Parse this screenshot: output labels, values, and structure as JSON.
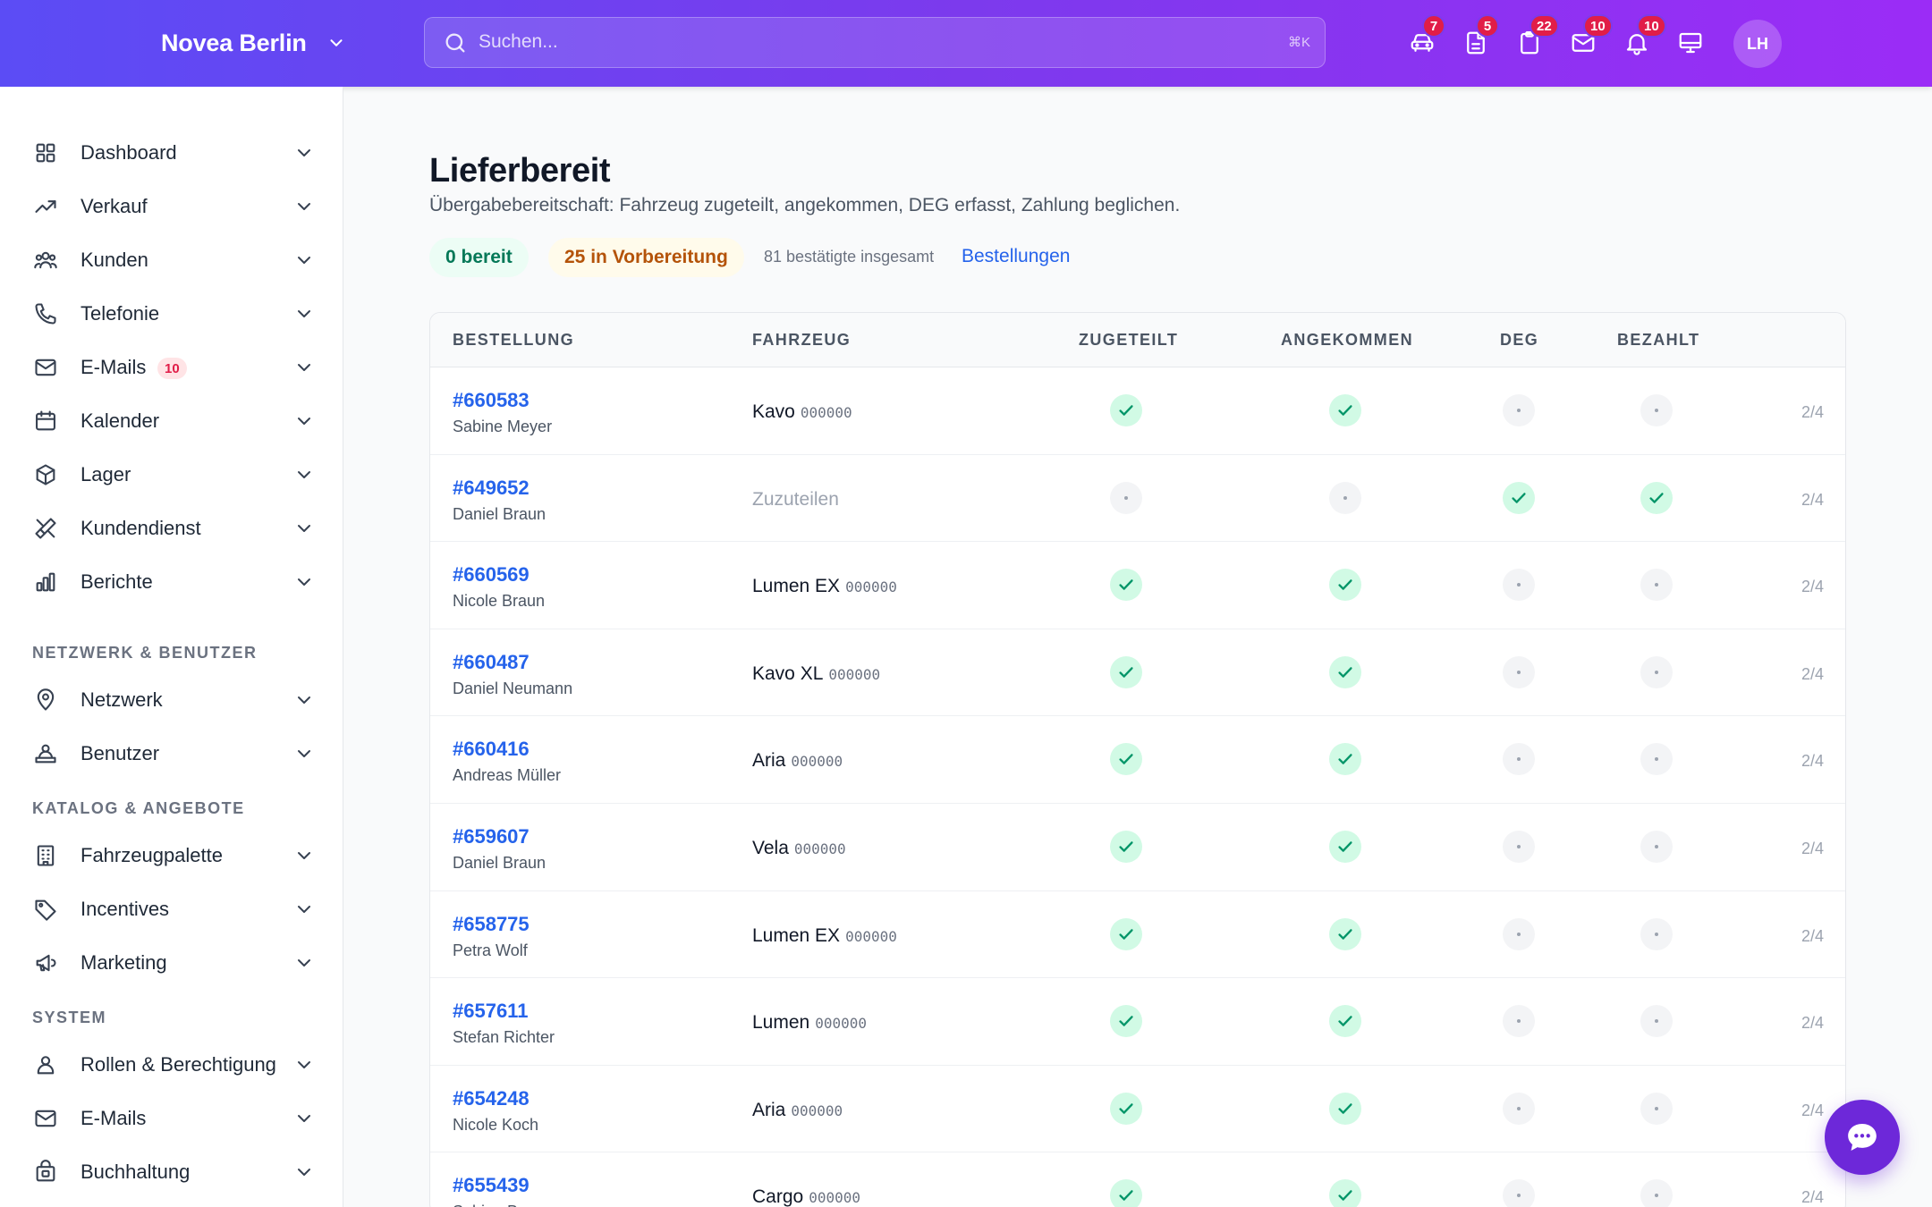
{
  "header": {
    "brand": "Novea Berlin",
    "search_placeholder": "Suchen...",
    "search_shortcut": "⌘K",
    "badges": {
      "vehicles": "7",
      "documents": "5",
      "clipboard": "22",
      "mail": "10",
      "notifications": "10"
    },
    "avatar_initials": "LH"
  },
  "sidebar": {
    "items": [
      {
        "label": "Dashboard"
      },
      {
        "label": "Verkauf"
      },
      {
        "label": "Kunden"
      },
      {
        "label": "Telefonie"
      },
      {
        "label": "E-Mails",
        "badge": "10"
      },
      {
        "label": "Kalender"
      },
      {
        "label": "Lager"
      },
      {
        "label": "Kundendienst"
      },
      {
        "label": "Berichte"
      }
    ],
    "sections": [
      {
        "title": "NETZWERK & BENUTZER",
        "items": [
          {
            "label": "Netzwerk"
          },
          {
            "label": "Benutzer"
          }
        ]
      },
      {
        "title": "KATALOG & ANGEBOTE",
        "items": [
          {
            "label": "Fahrzeugpalette"
          },
          {
            "label": "Incentives"
          },
          {
            "label": "Marketing"
          }
        ]
      },
      {
        "title": "SYSTEM",
        "items": [
          {
            "label": "Rollen & Berechtigung"
          },
          {
            "label": "E-Mails"
          },
          {
            "label": "Buchhaltung"
          }
        ]
      }
    ]
  },
  "main": {
    "title": "Lieferbereit",
    "subtitle": "Übergabebereitschaft: Fahrzeug zugeteilt, angekommen, DEG erfasst, Zahlung beglichen.",
    "stat_ready": "0 bereit",
    "stat_prep": "25 in Vorbereitung",
    "stat_total": "81 bestätigte insgesamt",
    "orders_link": "Bestellungen",
    "columns": [
      "BESTELLUNG",
      "FAHRZEUG",
      "ZUGETEILT",
      "ANGEKOMMEN",
      "DEG",
      "BEZAHLT"
    ],
    "rows": [
      {
        "order": "#660583",
        "customer": "Sabine Meyer",
        "vehicle": "Kavo",
        "code": "000000",
        "assigned": true,
        "arrived": true,
        "deg": false,
        "paid": false,
        "progress": "2/4"
      },
      {
        "order": "#649652",
        "customer": "Daniel Braun",
        "vehicle": "Zuzuteilen",
        "code": "",
        "assigned": false,
        "arrived": false,
        "deg": true,
        "paid": true,
        "progress": "2/4"
      },
      {
        "order": "#660569",
        "customer": "Nicole Braun",
        "vehicle": "Lumen EX",
        "code": "000000",
        "assigned": true,
        "arrived": true,
        "deg": false,
        "paid": false,
        "progress": "2/4"
      },
      {
        "order": "#660487",
        "customer": "Daniel Neumann",
        "vehicle": "Kavo XL",
        "code": "000000",
        "assigned": true,
        "arrived": true,
        "deg": false,
        "paid": false,
        "progress": "2/4"
      },
      {
        "order": "#660416",
        "customer": "Andreas Müller",
        "vehicle": "Aria",
        "code": "000000",
        "assigned": true,
        "arrived": true,
        "deg": false,
        "paid": false,
        "progress": "2/4"
      },
      {
        "order": "#659607",
        "customer": "Daniel Braun",
        "vehicle": "Vela",
        "code": "000000",
        "assigned": true,
        "arrived": true,
        "deg": false,
        "paid": false,
        "progress": "2/4"
      },
      {
        "order": "#658775",
        "customer": "Petra Wolf",
        "vehicle": "Lumen EX",
        "code": "000000",
        "assigned": true,
        "arrived": true,
        "deg": false,
        "paid": false,
        "progress": "2/4"
      },
      {
        "order": "#657611",
        "customer": "Stefan Richter",
        "vehicle": "Lumen",
        "code": "000000",
        "assigned": true,
        "arrived": true,
        "deg": false,
        "paid": false,
        "progress": "2/4"
      },
      {
        "order": "#654248",
        "customer": "Nicole Koch",
        "vehicle": "Aria",
        "code": "000000",
        "assigned": true,
        "arrived": true,
        "deg": false,
        "paid": false,
        "progress": "2/4"
      },
      {
        "order": "#655439",
        "customer": "Sabine Braun",
        "vehicle": "Cargo",
        "code": "000000",
        "assigned": true,
        "arrived": true,
        "deg": false,
        "paid": false,
        "progress": "2/4"
      }
    ]
  },
  "colors": {
    "accent": "#7c3aed",
    "link": "#2563eb",
    "success": "#10b981",
    "badge": "#e11d48"
  }
}
